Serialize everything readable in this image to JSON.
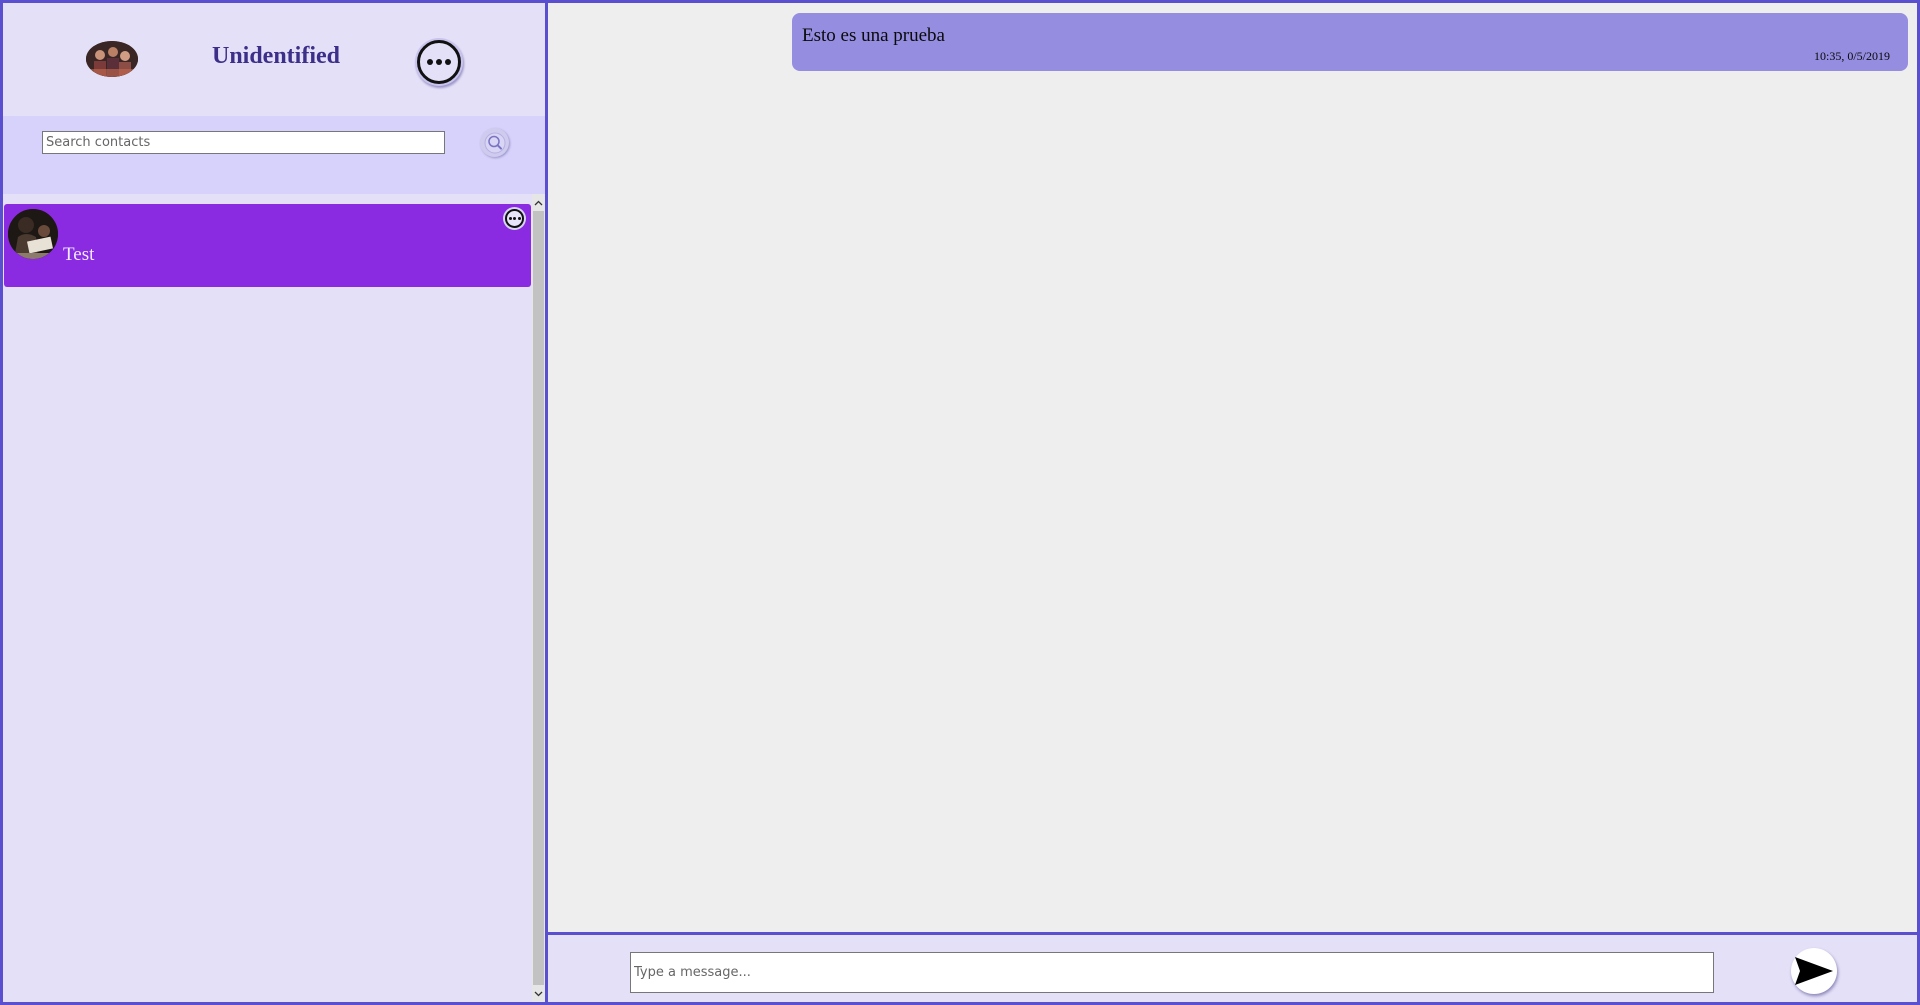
{
  "profile": {
    "name": "Unidentified",
    "avatar_icon": "user-avatar-icon",
    "menu_icon": "more-options-icon"
  },
  "search": {
    "placeholder": "Search contacts",
    "value": "",
    "button_icon": "search-icon"
  },
  "contacts": [
    {
      "name": "Test",
      "avatar_icon": "contact-avatar-icon",
      "menu_icon": "more-options-icon",
      "selected": true
    }
  ],
  "messages": [
    {
      "text": "Esto es una prueba",
      "time": "10:35, 0/5/2019"
    }
  ],
  "composer": {
    "placeholder": "Type a message...",
    "value": "",
    "send_icon": "send-arrow-icon"
  },
  "colors": {
    "accent_border": "#5a4fcf",
    "panel_bg": "#e4e0f7",
    "search_bg": "#d6d2fb",
    "contact_selected": "#8a2be2",
    "message_bubble": "#958de0",
    "chat_bg": "#eeeeee"
  }
}
